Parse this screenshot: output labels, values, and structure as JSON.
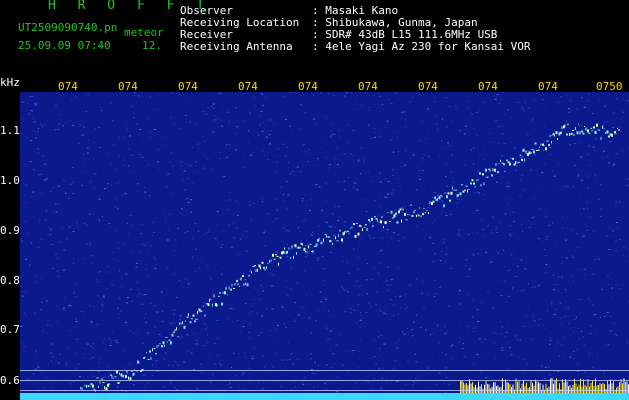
{
  "header": {
    "program": "H R O F F T",
    "filename": "UT2509090740.pn",
    "tag": "meteor",
    "datetime": "25.09.09 07:40",
    "extra": "12.",
    "fields": [
      {
        "label": "Observer",
        "value": ": Masaki Kano"
      },
      {
        "label": "Receiving Location",
        "value": ": Shibukawa, Gunma, Japan"
      },
      {
        "label": "Receiver",
        "value": ": SDR# 43dB L15 111.6MHz USB"
      },
      {
        "label": "Receiving Antenna",
        "value": ": 4ele Yagi Az 230 for Kansai VOR"
      }
    ]
  },
  "axis": {
    "unit": "kHz",
    "x_ticks": [
      "074",
      "074",
      "074",
      "074",
      "074",
      "074",
      "074",
      "074",
      "074",
      "0750"
    ],
    "y_ticks": [
      "1.1",
      "1.0",
      "0.9",
      "0.8",
      "0.7",
      "0.6"
    ]
  },
  "colors": {
    "background": "#000000",
    "noise": "#0a1a8c",
    "trace": "#7fe0ff",
    "header_green": "#1ec81e",
    "tick_yellow": "#ffd200"
  },
  "waterfall": {
    "trace_points_khz": [
      [
        0,
        0.58
      ],
      [
        0.1,
        0.62
      ],
      [
        0.2,
        0.72
      ],
      [
        0.35,
        0.84
      ],
      [
        0.5,
        0.9
      ],
      [
        0.65,
        0.95
      ],
      [
        0.8,
        1.04
      ],
      [
        0.9,
        1.1
      ],
      [
        1.0,
        1.1
      ]
    ]
  }
}
